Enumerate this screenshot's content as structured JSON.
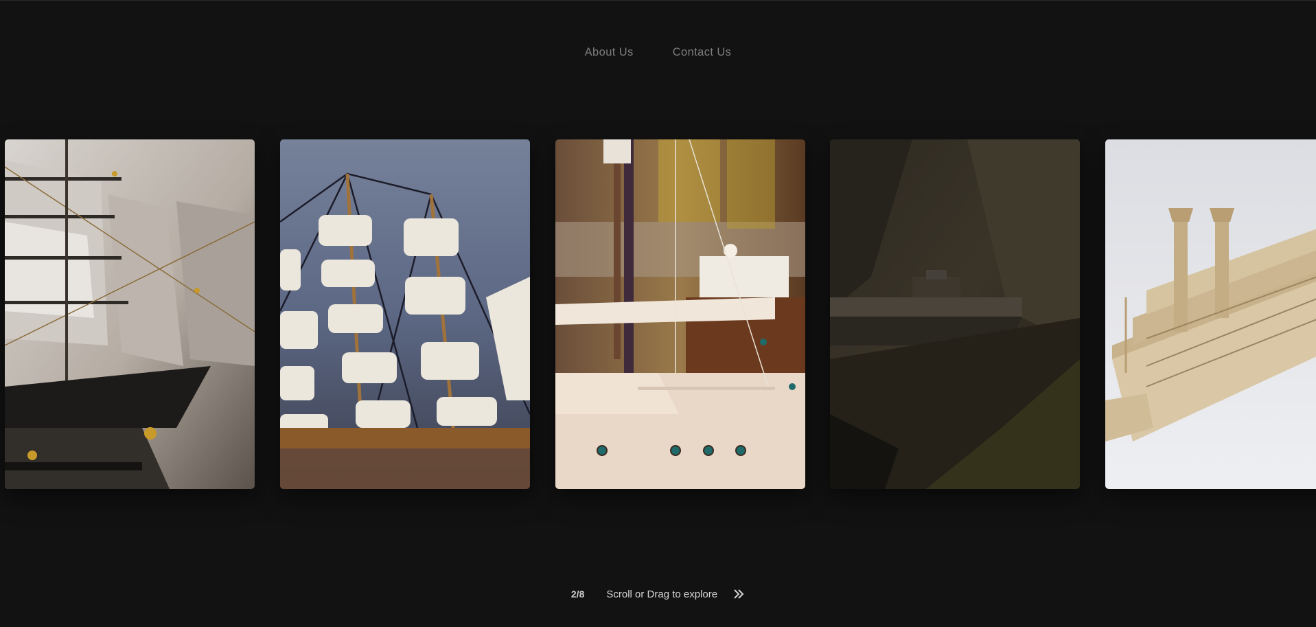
{
  "nav": {
    "items": [
      {
        "label": "About Us"
      },
      {
        "label": "Contact Us"
      }
    ]
  },
  "gallery": {
    "cards": [
      {
        "name": "tall sailing ship model"
      },
      {
        "name": "sailing ship model with white sails"
      },
      {
        "name": "steamboat model deck"
      },
      {
        "name": "ship wreck in dark landscape"
      },
      {
        "name": "wooden paddle steamer model"
      }
    ]
  },
  "footer": {
    "counter": "2/8",
    "hint": "Scroll or Drag to explore",
    "arrow_icon": "double-chevron-right-icon"
  },
  "colors": {
    "background": "#121212",
    "nav_text": "#7d7d7d",
    "footer_text": "#d6d6d6"
  }
}
